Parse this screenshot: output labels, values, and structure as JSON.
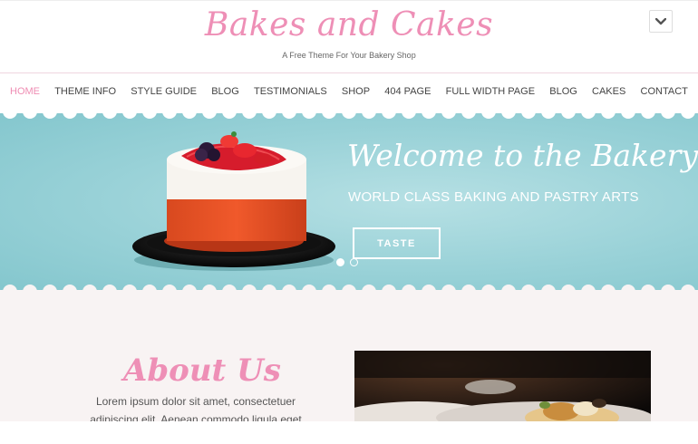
{
  "site": {
    "title": "Bakes and Cakes",
    "tagline": "A Free Theme For Your Bakery Shop"
  },
  "header": {
    "menu_toggle_icon": "chevron-down-icon"
  },
  "nav": {
    "items": [
      {
        "label": "HOME",
        "active": true
      },
      {
        "label": "THEME INFO"
      },
      {
        "label": "STYLE GUIDE"
      },
      {
        "label": "BLOG"
      },
      {
        "label": "TESTIMONIALS"
      },
      {
        "label": "SHOP"
      },
      {
        "label": "404 PAGE"
      },
      {
        "label": "FULL WIDTH PAGE"
      },
      {
        "label": "BLOG"
      },
      {
        "label": "CAKES"
      },
      {
        "label": "CONTACT"
      }
    ]
  },
  "hero": {
    "title": "Welcome to the Bakery",
    "subtitle": "WORLD CLASS BAKING AND PASTRY ARTS",
    "button_label": "TASTE",
    "slides_total": 2,
    "slide_active": 1
  },
  "about": {
    "title": "About Us",
    "text_line1": "Lorem ipsum dolor sit amet, consectetuer",
    "text_line2": "adipiscing elit. Aenean commodo ligula eget"
  },
  "colors": {
    "accent_pink": "#ee8fb6",
    "hero_teal": "#98d1d7",
    "about_bg": "#f8f3f3"
  }
}
